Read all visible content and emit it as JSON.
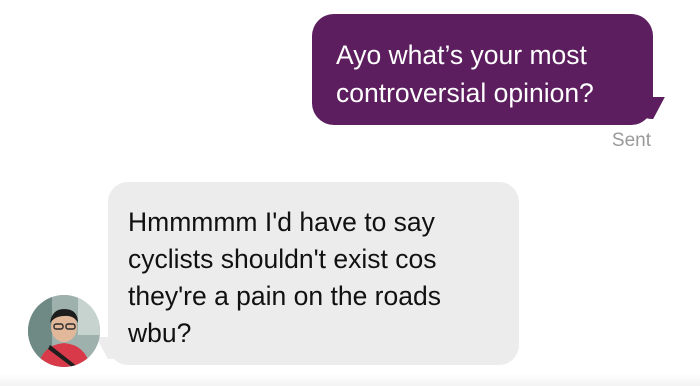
{
  "conversation": {
    "outgoing": {
      "line1": "Ayo what’s your most",
      "line2": "controversial opinion?",
      "status": "Sent",
      "bubble_color": "#5c1e5e"
    },
    "incoming": {
      "line1": "Hmmmmm I'd have to say",
      "line2": "cyclists shouldn't exist cos",
      "line3": "they're a pain on the roads",
      "line4": "wbu?",
      "bubble_color": "#ececec"
    },
    "avatar_icon": "contact-avatar-photo"
  }
}
